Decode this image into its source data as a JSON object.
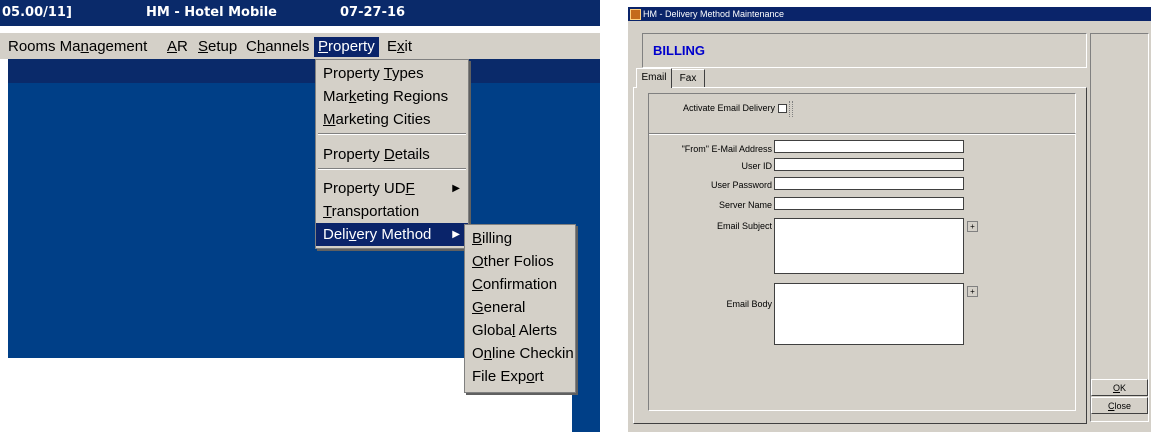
{
  "left_window": {
    "title_segments": {
      "version": "05.00/11]",
      "app": "HM - Hotel Mobile",
      "date": "07-27-16"
    },
    "menu": [
      "Rooms Management",
      "AR",
      "Setup",
      "Channels",
      "Property",
      "Exit"
    ],
    "property_menu": [
      "Property Types",
      "Marketing Regions",
      "Marketing Cities",
      "Property Details",
      "Property UDF",
      "Transportation",
      "Delivery Method"
    ],
    "delivery_submenu": [
      "Billing",
      "Other Folios",
      "Confirmation",
      "General",
      "Global Alerts",
      "Online Checkin",
      "File Export"
    ]
  },
  "dialog": {
    "title": "HM - Delivery Method Maintenance",
    "header": "BILLING",
    "tabs": [
      "Email",
      "Fax"
    ],
    "activate_label": "Activate Email Delivery",
    "fields": {
      "from_email": {
        "label": "\"From\" E-Mail Address",
        "value": ""
      },
      "user_id": {
        "label": "User ID",
        "value": ""
      },
      "user_password": {
        "label": "User Password",
        "value": ""
      },
      "server_name": {
        "label": "Server Name",
        "value": ""
      },
      "email_subject": {
        "label": "Email Subject",
        "value": ""
      },
      "email_body": {
        "label": "Email Body",
        "value": ""
      }
    },
    "buttons": {
      "ok": "OK",
      "close": "Close"
    }
  },
  "colors": {
    "title_navy": "#0a2a6a",
    "desktop_blue": "#003f87",
    "selection": "#0a246a",
    "face": "#d4d0c8",
    "header_text": "#0000cc"
  }
}
